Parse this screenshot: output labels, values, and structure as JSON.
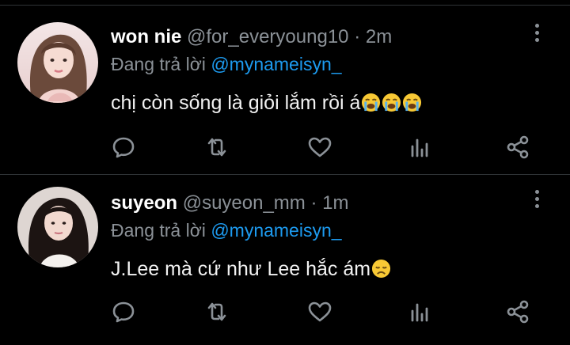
{
  "colors": {
    "background": "#000000",
    "divider": "#2f3336",
    "muted": "#8b9197",
    "link": "#1d9bf0",
    "name": "#ffffff"
  },
  "tweets": [
    {
      "display_name": "won nie",
      "handle": "@for_everyoung10",
      "separator": "·",
      "time": "2m",
      "reply_prefix": "Đang trả lời",
      "reply_to": "@mynameisyn_",
      "text": "chị còn sống là giỏi lắm rồi á",
      "emojis": [
        "loudly-crying-face",
        "loudly-crying-face",
        "loudly-crying-face"
      ],
      "action_icons": [
        "reply-icon",
        "retweet-icon",
        "like-icon",
        "views-icon",
        "share-icon"
      ]
    },
    {
      "display_name": "suyeon",
      "handle": "@suyeon_mm",
      "separator": "·",
      "time": "1m",
      "reply_prefix": "Đang trả lời",
      "reply_to": "@mynameisyn_",
      "text": "J.Lee mà cứ như Lee hắc ám",
      "emojis": [
        "disappointed-face"
      ],
      "action_icons": [
        "reply-icon",
        "retweet-icon",
        "like-icon",
        "views-icon",
        "share-icon"
      ]
    }
  ]
}
